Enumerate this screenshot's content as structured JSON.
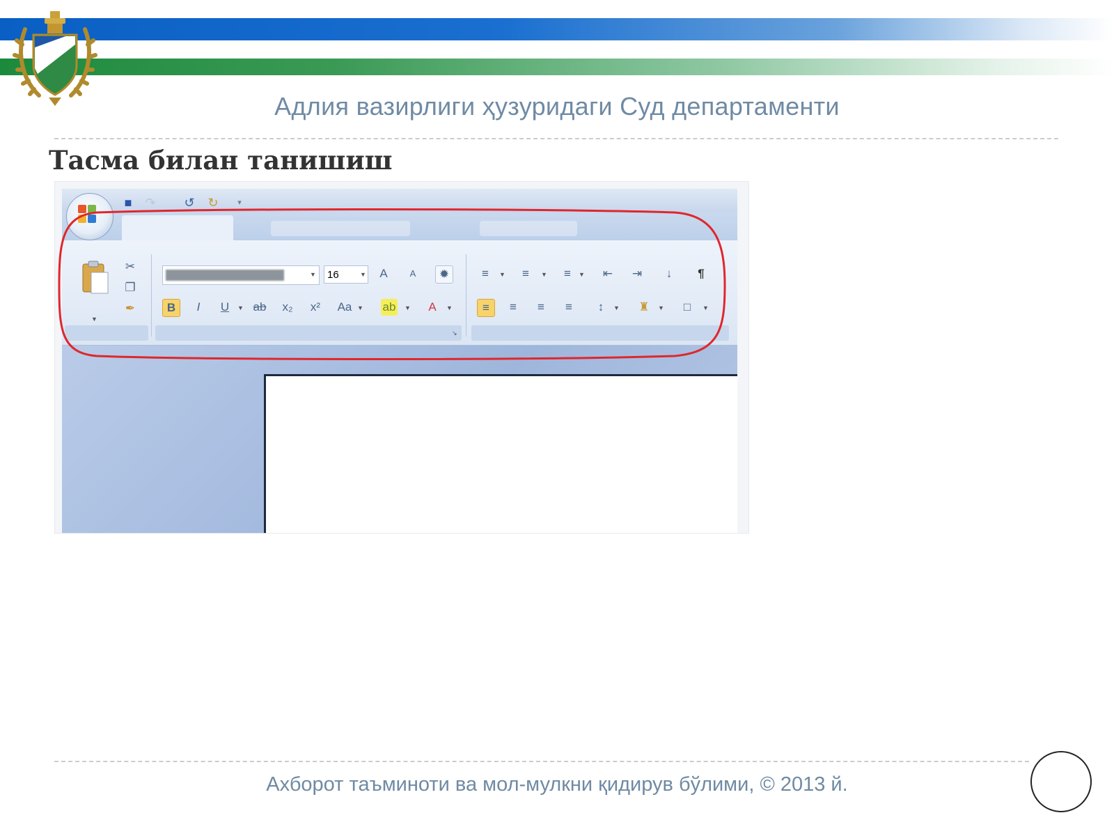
{
  "header": {
    "title": "Адлия вазирлиги ҳузуридаги Суд департаменти",
    "emblem_icon": "coat-of-arms-icon",
    "colors": {
      "blue_stripe": "#0a5fc4",
      "green_stripe": "#1c8a3c",
      "title_color": "#6f8aa3"
    }
  },
  "slide": {
    "title": "Тасма билан танишиш"
  },
  "screenshot": {
    "description_icons": [
      "office-button-icon",
      "save-icon",
      "undo-icon",
      "redo-icon",
      "customize-qat-icon"
    ],
    "ribbon": {
      "font_size_value": "16",
      "highlight_color": "#e0262c",
      "groups": [
        "clipboard",
        "font",
        "paragraph"
      ]
    }
  },
  "footer": {
    "text": "Ахборот таъминоти ва мол-мулкни қидирув бўлими, © 2013 й."
  }
}
